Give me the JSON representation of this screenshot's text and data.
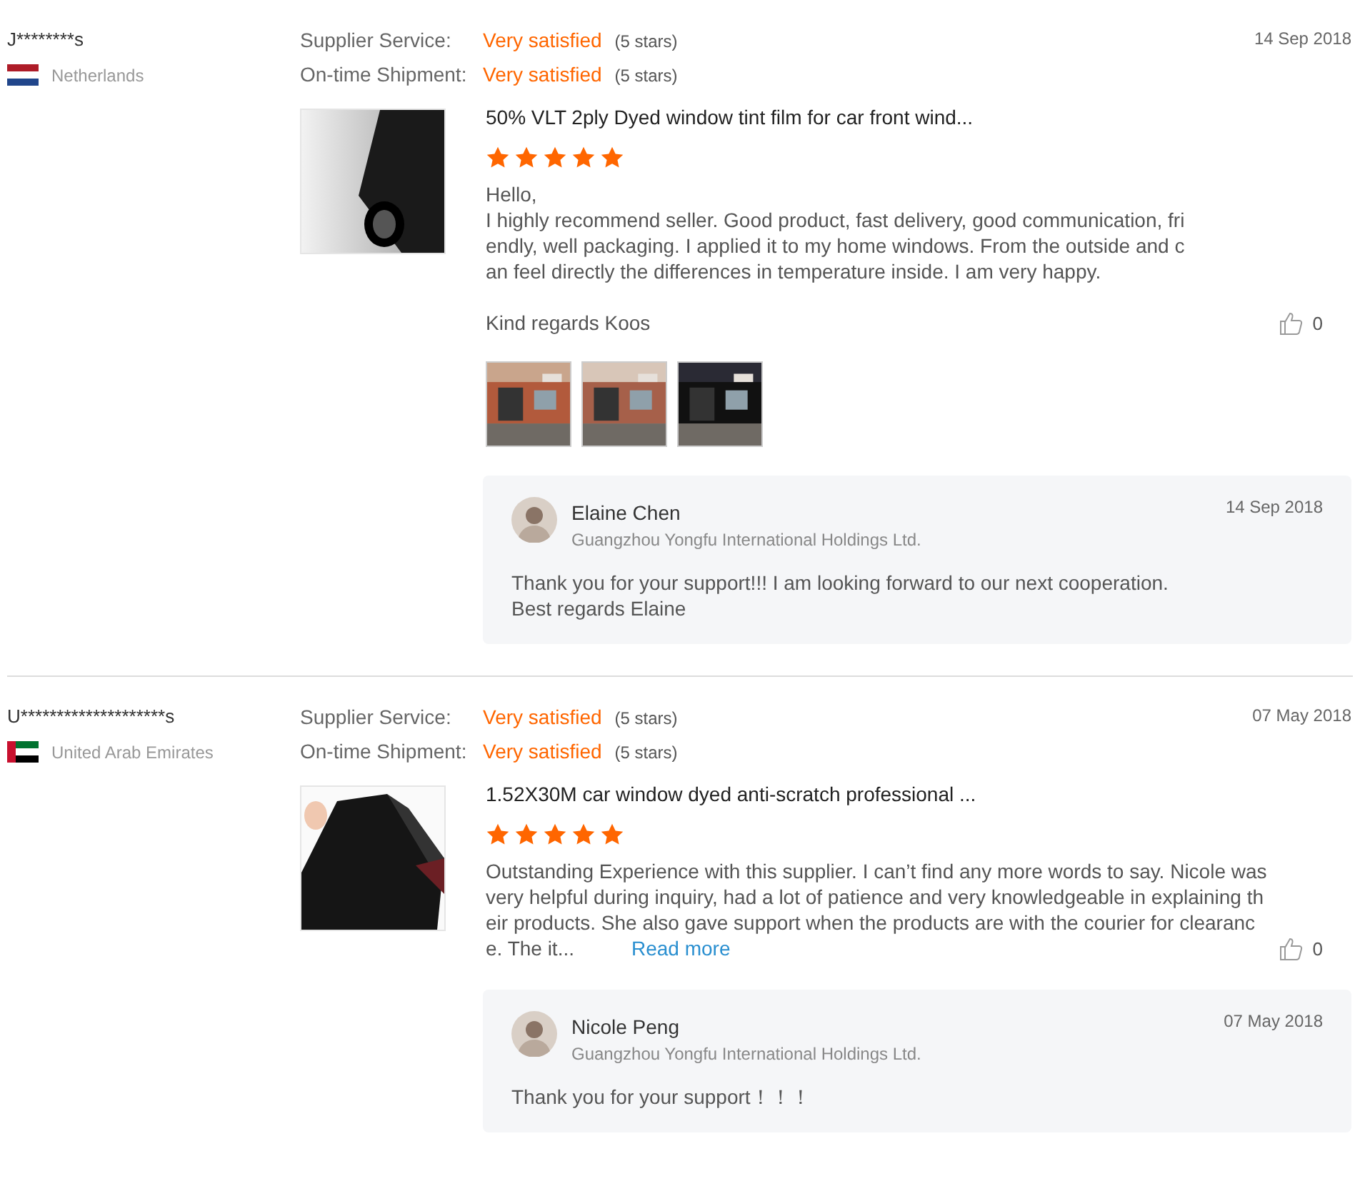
{
  "reviews": [
    {
      "buyer": "J********s",
      "country": "Netherlands",
      "flag": {
        "kind": "nl"
      },
      "date": "14 Sep 2018",
      "ratings": [
        {
          "label": "Supplier Service:",
          "value": "Very satisfied",
          "note": "(5 stars)"
        },
        {
          "label": "On-time Shipment:",
          "value": "Very satisfied",
          "note": "(5 stars)"
        }
      ],
      "product": {
        "title": "50% VLT 2ply Dyed window tint film for car front wind...",
        "image": {
          "kind": "picture"
        }
      },
      "stars": 5,
      "body": "Hello,\nI highly recommend seller. Good product, fast delivery, good communication, fri\nendly, well packaging. I applied it to my home windows. From the outside and c\nan feel directly the differences in temperature inside. I am very happy.\n\nKind regards Koos",
      "likes": "0",
      "photos": [
        {
          "kind": "picture"
        },
        {
          "kind": "picture"
        },
        {
          "kind": "picture"
        }
      ],
      "reply": {
        "name": "Elaine Chen",
        "company": "Guangzhou Yongfu International Holdings Ltd.",
        "date": "14 Sep 2018",
        "text": "Thank you for your support!!! I am looking forward to our next cooperation.\nBest regards Elaine"
      }
    },
    {
      "buyer": "U********************s",
      "country": "United Arab Emirates",
      "flag": {
        "kind": "ae"
      },
      "date": "07 May 2018",
      "ratings": [
        {
          "label": "Supplier Service:",
          "value": "Very satisfied",
          "note": "(5 stars)"
        },
        {
          "label": "On-time Shipment:",
          "value": "Very satisfied",
          "note": "(5 stars)"
        }
      ],
      "product": {
        "title": "1.52X30M car window dyed anti-scratch professional ...",
        "image": {
          "kind": "picture"
        }
      },
      "stars": 5,
      "body": "Outstanding Experience with this supplier. I can’t find any more words to say. Nicole was\nvery helpful during inquiry, had a lot of patience and very knowledgeable in explaining th\neir products. She also gave support when the products are with the courier for clearanc\ne. The it...",
      "read_more": "Read more",
      "likes": "0",
      "reply": {
        "name": "Nicole Peng",
        "company": "Guangzhou Yongfu International Holdings Ltd.",
        "date": "07 May 2018",
        "text": "Thank you for your support！！！"
      }
    }
  ]
}
